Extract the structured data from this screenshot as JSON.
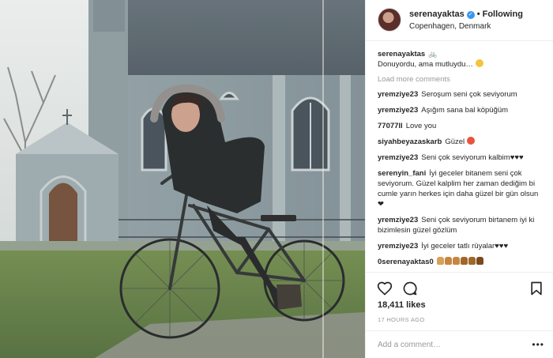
{
  "post": {
    "username": "serenayaktas",
    "follow_status": "Following",
    "location": "Copenhagen, Denmark",
    "caption_user": "serenayaktas",
    "caption_text": "Donuyordu, ama mutluydu…"
  },
  "load_more": "Load more comments",
  "comments": [
    {
      "user": "yremziye23",
      "text": "Seroşum seni çok seviyorum"
    },
    {
      "user": "yremziye23",
      "text": "Aşığım sana bal köpüğüm"
    },
    {
      "user": "77077ll",
      "text": "Love you"
    },
    {
      "user": "siyahbeyazaskarb",
      "text": "Güzel"
    },
    {
      "user": "yremziye23",
      "text": "Seni çok seviyorum kalbim♥♥♥"
    },
    {
      "user": "serenyin_fani",
      "text": "İyi geceler bitanem seni çok seviyorum. Güzel kalplim her zaman dediğim bi cumle yarın herkes için daha güzel bir gün olsun ❤"
    },
    {
      "user": "yremziye23",
      "text": "Seni çok seviyorum birtanem iyi ki bizimlesin güzel gözlüm"
    },
    {
      "user": "yremziye23",
      "text": "İyi geceler tatlı rüyalar♥♥♥"
    },
    {
      "user": "0serenayaktas0",
      "text": ""
    }
  ],
  "likes": "18,411 likes",
  "time_ago": "17 HOURS AGO",
  "add_comment_placeholder": "Add a comment…",
  "icons": {
    "like": "heart-icon",
    "comment": "comment-bubble-icon",
    "save": "bookmark-icon",
    "verified": "verified-badge-icon",
    "more": "more-options-icon"
  },
  "colors": {
    "verified_blue": "#3897f0",
    "text": "#262626",
    "muted": "#999999",
    "border": "#efefef"
  }
}
